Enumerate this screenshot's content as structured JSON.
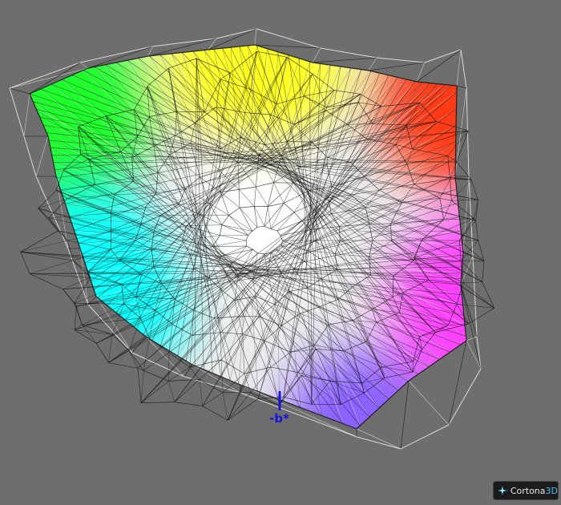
{
  "viewer": {
    "background_color": "#6e6e6e",
    "wireframe_color": "#111111",
    "reference_wireframe_color": "#ffffff"
  },
  "axis": {
    "label": "-b*",
    "color": "#1515e0"
  },
  "gamut_colors": {
    "green": "#1aff2a",
    "yellow": "#ffff20",
    "red": "#ff3a18",
    "magenta": "#ff40ff",
    "blue_violet": "#8a60ff",
    "cyan": "#10ffff",
    "white": "#ffffff"
  },
  "logo": {
    "text": "Cortona",
    "accent": "3D",
    "icon": "cortona-star-icon"
  }
}
